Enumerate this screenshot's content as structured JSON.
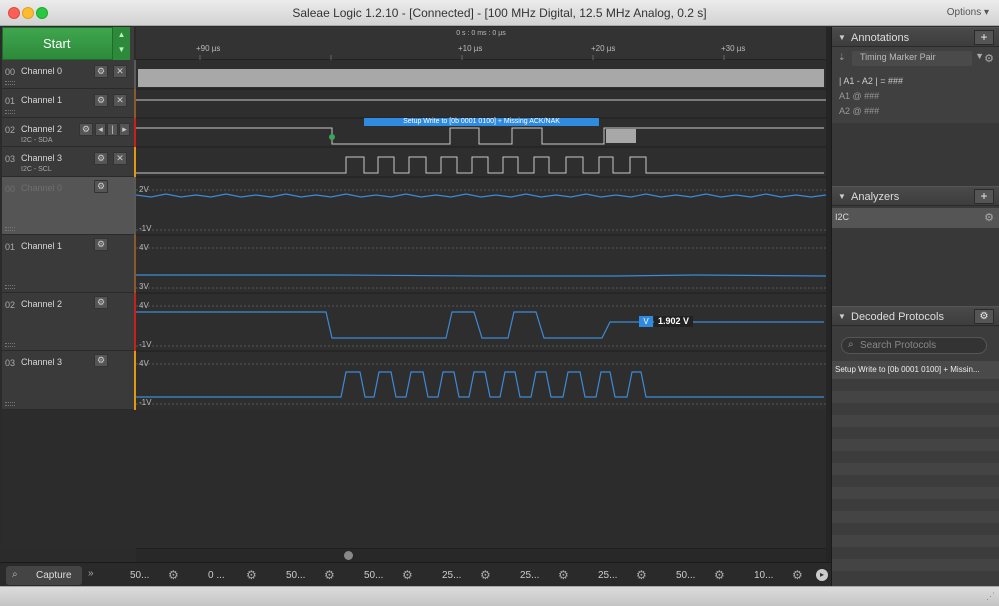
{
  "window": {
    "title": "Saleae Logic 1.2.10 - [Connected] - [100 MHz Digital, 12.5 MHz Analog, 0.2 s]",
    "options": "Options ▾"
  },
  "toolbar": {
    "start_label": "Start"
  },
  "timeline": {
    "origin": "0 s : 0 ms : 0 µs",
    "ticks": [
      "+90 µs",
      "+10 µs",
      "+20 µs",
      "+30 µs"
    ]
  },
  "channels": [
    {
      "num": "00",
      "name": "Channel 0",
      "sub": ""
    },
    {
      "num": "01",
      "name": "Channel 1",
      "sub": ""
    },
    {
      "num": "02",
      "name": "Channel 2",
      "sub": "I2C - SDA"
    },
    {
      "num": "03",
      "name": "Channel 3",
      "sub": "I2C - SCL"
    },
    {
      "num": "00",
      "name": "Channel 0",
      "sub": ""
    },
    {
      "num": "01",
      "name": "Channel 1",
      "sub": ""
    },
    {
      "num": "02",
      "name": "Channel 2",
      "sub": ""
    },
    {
      "num": "03",
      "name": "Channel 3",
      "sub": ""
    }
  ],
  "analog_scales": [
    {
      "top": "2V",
      "bottom": "-1V"
    },
    {
      "top": "4V",
      "bottom": "3V"
    },
    {
      "top": "4V",
      "bottom": "-1V"
    },
    {
      "top": "4V",
      "bottom": "-1V"
    }
  ],
  "decode_bubble": "Setup Write to [0b  0001  0100] + Missing ACK/NAK",
  "measurement": {
    "badge": "V",
    "value": "1.902 V"
  },
  "bottom_bar": {
    "capture": "Capture",
    "overflow": "»",
    "tabs": [
      "50...",
      "0 ...",
      "50...",
      "50...",
      "25...",
      "25...",
      "25...",
      "50...",
      "10..."
    ]
  },
  "right_panel": {
    "annotations": {
      "title": "Annotations",
      "timing": "Timing Marker Pair",
      "lines": [
        "| A1 - A2 | = ###",
        "A1  @  ###",
        "A2  @  ###"
      ]
    },
    "analyzers": {
      "title": "Analyzers",
      "items": [
        "I2C"
      ]
    },
    "decoded": {
      "title": "Decoded Protocols",
      "search_placeholder": "Search Protocols",
      "items": [
        "Setup Write to [0b  0001  0100] + Missin..."
      ]
    }
  },
  "colors": {
    "channel_strips": [
      "#5a5a5a",
      "#8a5a2a",
      "#c8201a",
      "#e09a10",
      "#5a5a5a",
      "#8a5a2a",
      "#c8201a",
      "#e09a10"
    ],
    "analog_trace": "#3c8ad8",
    "decode_bubble": "#2f8be0",
    "start_green": "#3fa64e"
  },
  "icons": {
    "gear": "⚙",
    "close": "✕",
    "plus": "+",
    "triangle": "▼",
    "search": "⌕"
  }
}
